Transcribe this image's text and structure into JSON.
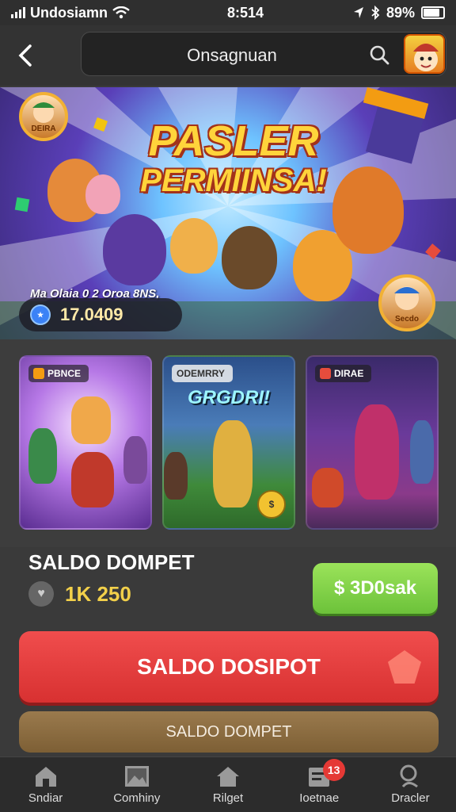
{
  "status_bar": {
    "carrier": "Undosiamn",
    "time": "8:514",
    "battery": "89%"
  },
  "header": {
    "title": "Onsagnuan"
  },
  "hero": {
    "title_line1": "PASLER",
    "title_line2": "PERMIINSA!",
    "subtitle": "Ma Olaia 0 2 Oroa 8NS,",
    "balance_value": "17.0409",
    "badge_left": "DEIRA",
    "badge_right": "Secdo"
  },
  "cards": [
    {
      "tag": "PBNCE",
      "headline": ""
    },
    {
      "tag": "ODEMRRY",
      "headline": "GRGDRI!"
    },
    {
      "tag": "DIRAE",
      "headline": ""
    }
  ],
  "wallet": {
    "title": "SALDO DOMPET",
    "value": "1K 250",
    "green_button": "$ 3D0sak",
    "primary_button": "SALDO DOSIPOT",
    "secondary_button": "SALDO DOMPET"
  },
  "tabbar": {
    "items": [
      {
        "label": "Sndiar",
        "icon": "home-icon"
      },
      {
        "label": "Comhiny",
        "icon": "image-icon"
      },
      {
        "label": "Rilget",
        "icon": "house-icon"
      },
      {
        "label": "Ioetnae",
        "icon": "inbox-icon",
        "badge": "13"
      },
      {
        "label": "Dracler",
        "icon": "search-icon"
      }
    ]
  },
  "colors": {
    "accent_red": "#e03a3a",
    "accent_green": "#7ed04a",
    "accent_gold": "#f2d04a",
    "secondary_brown": "#8c6d42"
  }
}
